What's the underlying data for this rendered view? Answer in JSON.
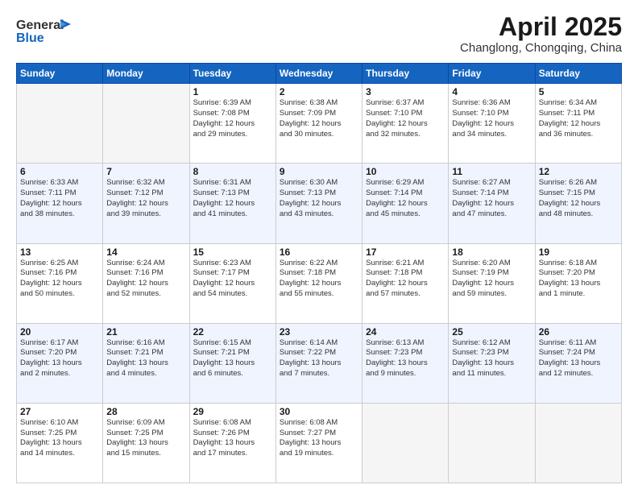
{
  "logo": {
    "general": "General",
    "blue": "Blue"
  },
  "title": "April 2025",
  "subtitle": "Changlong, Chongqing, China",
  "days_header": [
    "Sunday",
    "Monday",
    "Tuesday",
    "Wednesday",
    "Thursday",
    "Friday",
    "Saturday"
  ],
  "weeks": [
    [
      {
        "day": "",
        "info": ""
      },
      {
        "day": "",
        "info": ""
      },
      {
        "day": "1",
        "info": "Sunrise: 6:39 AM\nSunset: 7:08 PM\nDaylight: 12 hours\nand 29 minutes."
      },
      {
        "day": "2",
        "info": "Sunrise: 6:38 AM\nSunset: 7:09 PM\nDaylight: 12 hours\nand 30 minutes."
      },
      {
        "day": "3",
        "info": "Sunrise: 6:37 AM\nSunset: 7:10 PM\nDaylight: 12 hours\nand 32 minutes."
      },
      {
        "day": "4",
        "info": "Sunrise: 6:36 AM\nSunset: 7:10 PM\nDaylight: 12 hours\nand 34 minutes."
      },
      {
        "day": "5",
        "info": "Sunrise: 6:34 AM\nSunset: 7:11 PM\nDaylight: 12 hours\nand 36 minutes."
      }
    ],
    [
      {
        "day": "6",
        "info": "Sunrise: 6:33 AM\nSunset: 7:11 PM\nDaylight: 12 hours\nand 38 minutes."
      },
      {
        "day": "7",
        "info": "Sunrise: 6:32 AM\nSunset: 7:12 PM\nDaylight: 12 hours\nand 39 minutes."
      },
      {
        "day": "8",
        "info": "Sunrise: 6:31 AM\nSunset: 7:13 PM\nDaylight: 12 hours\nand 41 minutes."
      },
      {
        "day": "9",
        "info": "Sunrise: 6:30 AM\nSunset: 7:13 PM\nDaylight: 12 hours\nand 43 minutes."
      },
      {
        "day": "10",
        "info": "Sunrise: 6:29 AM\nSunset: 7:14 PM\nDaylight: 12 hours\nand 45 minutes."
      },
      {
        "day": "11",
        "info": "Sunrise: 6:27 AM\nSunset: 7:14 PM\nDaylight: 12 hours\nand 47 minutes."
      },
      {
        "day": "12",
        "info": "Sunrise: 6:26 AM\nSunset: 7:15 PM\nDaylight: 12 hours\nand 48 minutes."
      }
    ],
    [
      {
        "day": "13",
        "info": "Sunrise: 6:25 AM\nSunset: 7:16 PM\nDaylight: 12 hours\nand 50 minutes."
      },
      {
        "day": "14",
        "info": "Sunrise: 6:24 AM\nSunset: 7:16 PM\nDaylight: 12 hours\nand 52 minutes."
      },
      {
        "day": "15",
        "info": "Sunrise: 6:23 AM\nSunset: 7:17 PM\nDaylight: 12 hours\nand 54 minutes."
      },
      {
        "day": "16",
        "info": "Sunrise: 6:22 AM\nSunset: 7:18 PM\nDaylight: 12 hours\nand 55 minutes."
      },
      {
        "day": "17",
        "info": "Sunrise: 6:21 AM\nSunset: 7:18 PM\nDaylight: 12 hours\nand 57 minutes."
      },
      {
        "day": "18",
        "info": "Sunrise: 6:20 AM\nSunset: 7:19 PM\nDaylight: 12 hours\nand 59 minutes."
      },
      {
        "day": "19",
        "info": "Sunrise: 6:18 AM\nSunset: 7:20 PM\nDaylight: 13 hours\nand 1 minute."
      }
    ],
    [
      {
        "day": "20",
        "info": "Sunrise: 6:17 AM\nSunset: 7:20 PM\nDaylight: 13 hours\nand 2 minutes."
      },
      {
        "day": "21",
        "info": "Sunrise: 6:16 AM\nSunset: 7:21 PM\nDaylight: 13 hours\nand 4 minutes."
      },
      {
        "day": "22",
        "info": "Sunrise: 6:15 AM\nSunset: 7:21 PM\nDaylight: 13 hours\nand 6 minutes."
      },
      {
        "day": "23",
        "info": "Sunrise: 6:14 AM\nSunset: 7:22 PM\nDaylight: 13 hours\nand 7 minutes."
      },
      {
        "day": "24",
        "info": "Sunrise: 6:13 AM\nSunset: 7:23 PM\nDaylight: 13 hours\nand 9 minutes."
      },
      {
        "day": "25",
        "info": "Sunrise: 6:12 AM\nSunset: 7:23 PM\nDaylight: 13 hours\nand 11 minutes."
      },
      {
        "day": "26",
        "info": "Sunrise: 6:11 AM\nSunset: 7:24 PM\nDaylight: 13 hours\nand 12 minutes."
      }
    ],
    [
      {
        "day": "27",
        "info": "Sunrise: 6:10 AM\nSunset: 7:25 PM\nDaylight: 13 hours\nand 14 minutes."
      },
      {
        "day": "28",
        "info": "Sunrise: 6:09 AM\nSunset: 7:25 PM\nDaylight: 13 hours\nand 15 minutes."
      },
      {
        "day": "29",
        "info": "Sunrise: 6:08 AM\nSunset: 7:26 PM\nDaylight: 13 hours\nand 17 minutes."
      },
      {
        "day": "30",
        "info": "Sunrise: 6:08 AM\nSunset: 7:27 PM\nDaylight: 13 hours\nand 19 minutes."
      },
      {
        "day": "",
        "info": ""
      },
      {
        "day": "",
        "info": ""
      },
      {
        "day": "",
        "info": ""
      }
    ]
  ]
}
